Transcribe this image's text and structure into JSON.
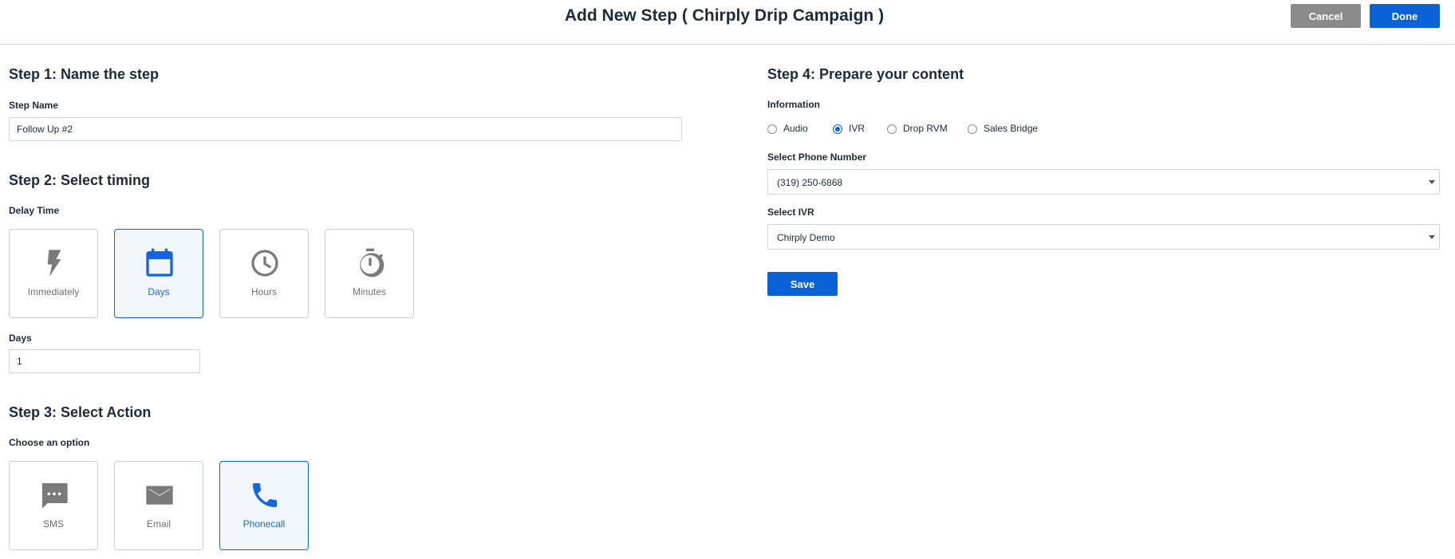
{
  "header": {
    "title": "Add New Step ( Chirply Drip Campaign )",
    "cancel_label": "Cancel",
    "done_label": "Done"
  },
  "step1": {
    "title": "Step 1: Name the step",
    "field_label": "Step Name",
    "value": "Follow Up #2"
  },
  "step2": {
    "title": "Step 2: Select timing",
    "delay_label": "Delay Time",
    "options": [
      {
        "label": "Immediately",
        "icon": "lightning-icon",
        "selected": false
      },
      {
        "label": "Days",
        "icon": "calendar-icon",
        "selected": true
      },
      {
        "label": "Hours",
        "icon": "clock-icon",
        "selected": false
      },
      {
        "label": "Minutes",
        "icon": "stopwatch-icon",
        "selected": false
      }
    ],
    "amount_label": "Days",
    "amount_value": "1"
  },
  "step3": {
    "title": "Step 3: Select Action",
    "choose_label": "Choose an option",
    "options": [
      {
        "label": "SMS",
        "icon": "chat-bubble-icon",
        "selected": false
      },
      {
        "label": "Email",
        "icon": "envelope-icon",
        "selected": false
      },
      {
        "label": "Phonecall",
        "icon": "phone-icon",
        "selected": true
      }
    ]
  },
  "step4": {
    "title": "Step 4: Prepare your content",
    "info_label": "Information",
    "radio_options": [
      {
        "label": "Audio",
        "checked": false
      },
      {
        "label": "IVR",
        "checked": true
      },
      {
        "label": "Drop RVM",
        "checked": false
      },
      {
        "label": "Sales Bridge",
        "checked": false
      }
    ],
    "phone_label": "Select Phone Number",
    "phone_value": "(319) 250-6868",
    "ivr_label": "Select IVR",
    "ivr_value": "Chirply Demo",
    "save_label": "Save"
  },
  "colors": {
    "accent": "#0a63d6",
    "cancel": "#8a8a8a",
    "selected_tile_bg": "#f1f6fd",
    "text": "#1b2a3d"
  }
}
